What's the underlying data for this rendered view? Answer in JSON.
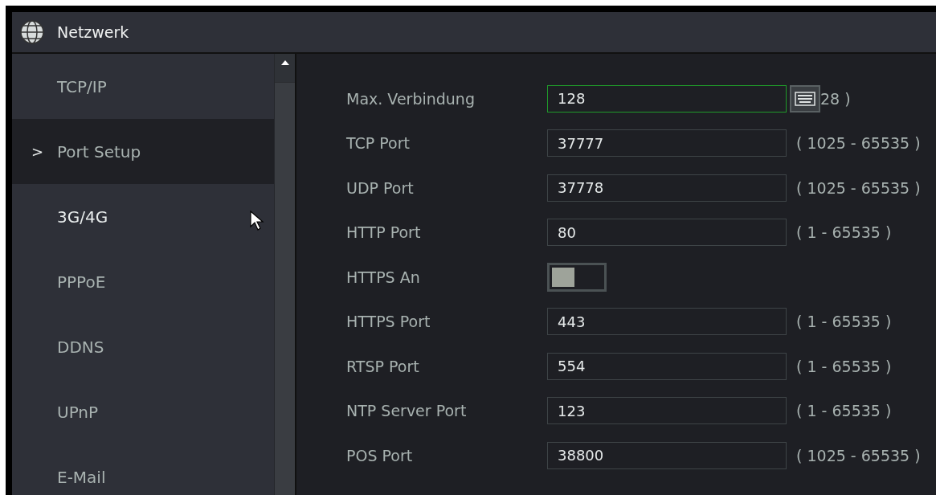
{
  "window": {
    "title": "Netzwerk"
  },
  "sidebar": {
    "items": [
      {
        "label": "TCP/IP",
        "selected": false,
        "hovered": false
      },
      {
        "label": "Port Setup",
        "selected": true,
        "hovered": false,
        "marker": ">"
      },
      {
        "label": "3G/4G",
        "selected": false,
        "hovered": true
      },
      {
        "label": "PPPoE",
        "selected": false,
        "hovered": false
      },
      {
        "label": "DDNS",
        "selected": false,
        "hovered": false
      },
      {
        "label": "UPnP",
        "selected": false,
        "hovered": false
      },
      {
        "label": "E-Mail",
        "selected": false,
        "hovered": false
      }
    ]
  },
  "settings": [
    {
      "kind": "field",
      "label": "Max. Verbindung",
      "value": "128",
      "focused": true,
      "keyboard": true,
      "range": "28 )"
    },
    {
      "kind": "field",
      "label": "TCP Port",
      "value": "37777",
      "focused": false,
      "range": "( 1025 - 65535 )"
    },
    {
      "kind": "field",
      "label": "UDP Port",
      "value": "37778",
      "focused": false,
      "range": "( 1025 - 65535 )"
    },
    {
      "kind": "field",
      "label": "HTTP Port",
      "value": "80",
      "focused": false,
      "range": "( 1 - 65535 )"
    },
    {
      "kind": "toggle",
      "label": "HTTPS An",
      "on": false
    },
    {
      "kind": "field",
      "label": "HTTPS Port",
      "value": "443",
      "focused": false,
      "range": "( 1 - 65535 )"
    },
    {
      "kind": "field",
      "label": "RTSP Port",
      "value": "554",
      "focused": false,
      "range": "( 1 - 65535 )"
    },
    {
      "kind": "field",
      "label": "NTP Server Port",
      "value": "123",
      "focused": false,
      "range": "( 1 - 65535 )"
    },
    {
      "kind": "field",
      "label": "POS Port",
      "value": "38800",
      "focused": false,
      "range": "( 1025 - 65535 )"
    }
  ]
}
